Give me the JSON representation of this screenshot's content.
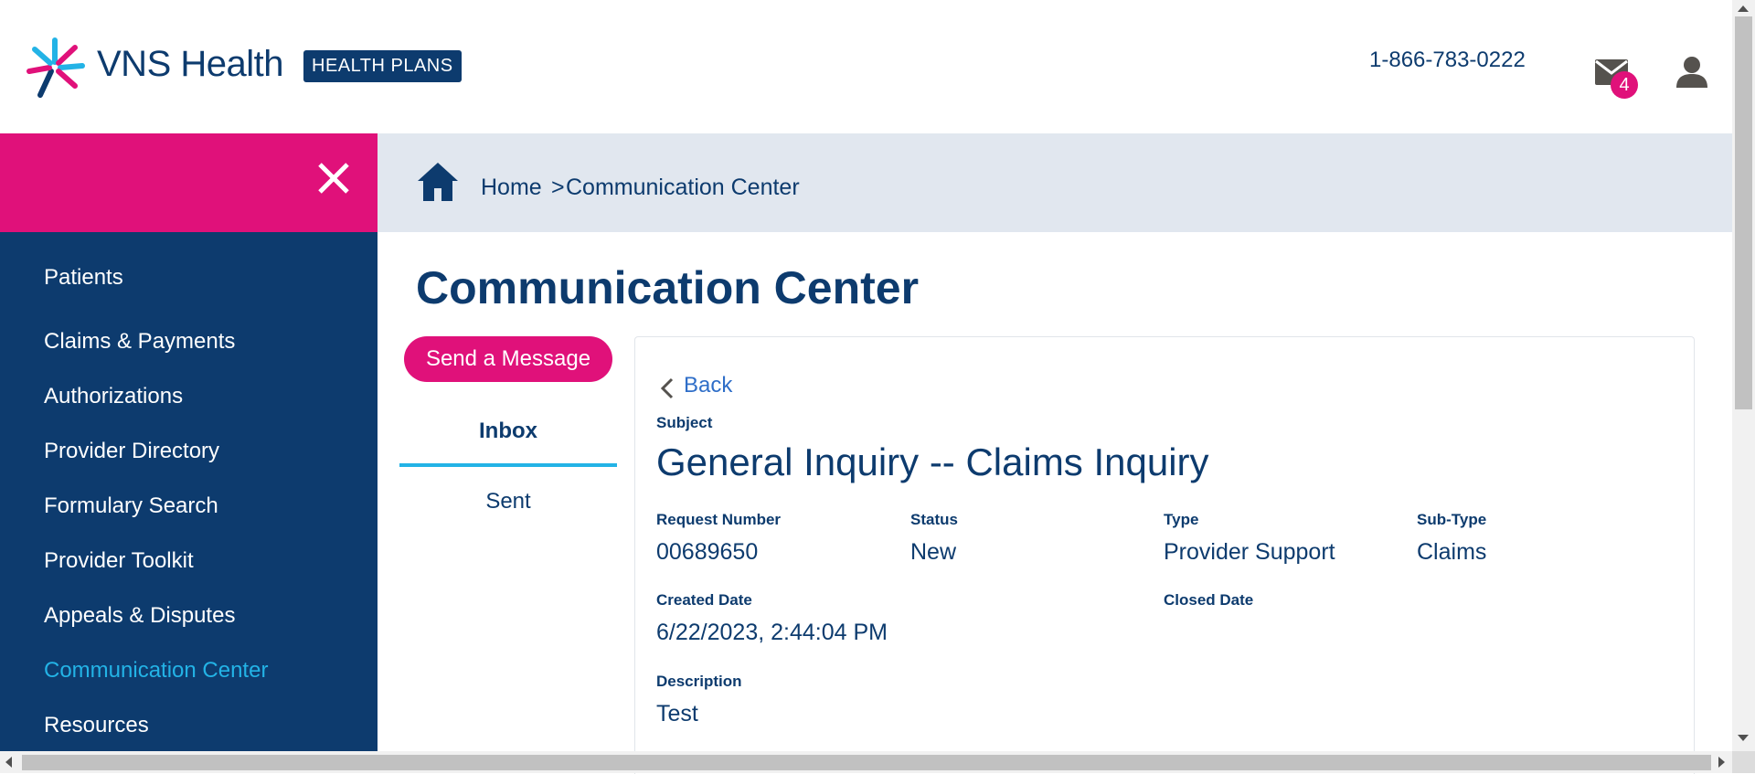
{
  "header": {
    "brand_name": "VNS Health",
    "brand_badge": "HEALTH PLANS",
    "phone": "1-866-783-0222",
    "mail_count": "4",
    "icons": [
      "logo-icon",
      "mail-icon",
      "user-icon",
      "close-icon",
      "home-icon",
      "chevron-left-icon"
    ]
  },
  "colors": {
    "primary": "#0d3b6e",
    "accent": "#e0117a",
    "active_link": "#23b3e6",
    "link": "#2f6ec8",
    "breadcrumb_bg": "#e1e7ef"
  },
  "sidebar": {
    "items": [
      {
        "label": "Patients"
      },
      {
        "label": "Claims & Payments"
      },
      {
        "label": "Authorizations"
      },
      {
        "label": "Provider Directory"
      },
      {
        "label": "Formulary Search"
      },
      {
        "label": "Provider Toolkit"
      },
      {
        "label": "Appeals & Disputes"
      },
      {
        "label": "Communication Center",
        "active": true
      },
      {
        "label": "Resources"
      }
    ]
  },
  "breadcrumb": {
    "home": "Home",
    "separator": ">",
    "current": "Communication Center"
  },
  "main": {
    "title": "Communication Center",
    "send_button": "Send a Message",
    "tabs": [
      {
        "label": "Inbox",
        "active": true
      },
      {
        "label": "Sent"
      }
    ]
  },
  "detail": {
    "back": "Back",
    "subject_label": "Subject",
    "subject": "General Inquiry -- Claims Inquiry",
    "request_number_label": "Request Number",
    "request_number": "00689650",
    "status_label": "Status",
    "status": "New",
    "type_label": "Type",
    "type": "Provider Support",
    "subtype_label": "Sub-Type",
    "subtype": "Claims",
    "created_label": "Created Date",
    "created": "6/22/2023, 2:44:04 PM",
    "closed_label": "Closed Date",
    "closed": "",
    "description_label": "Description",
    "description": "Test"
  }
}
